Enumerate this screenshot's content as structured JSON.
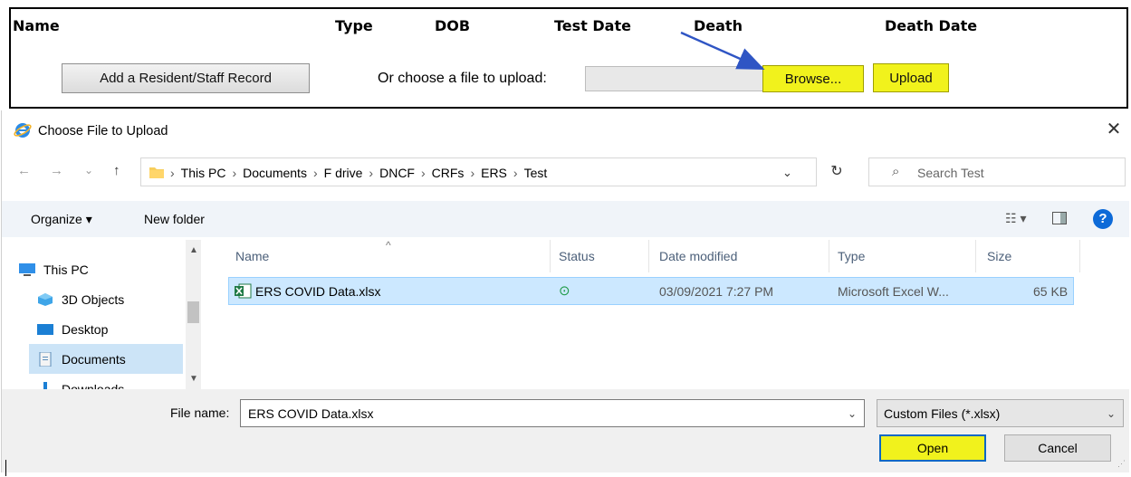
{
  "web_form": {
    "columns": [
      "Name",
      "Type",
      "DOB",
      "Test Date",
      "Death",
      "Death Date"
    ],
    "add_record_label": "Add a Resident/Staff Record",
    "upload_prompt": "Or choose a file to upload:",
    "browse_label": "Browse...",
    "upload_label": "Upload",
    "highlight_color": "#f1f21c",
    "arrow_color": "#2f55c4"
  },
  "dialog": {
    "title": "Choose File to Upload",
    "close_glyph": "✕",
    "nav": {
      "back": "←",
      "forward": "→",
      "recent": "⌄",
      "up": "↑"
    },
    "breadcrumb": [
      "This PC",
      "Documents",
      "F drive",
      "DNCF",
      "CRFs",
      "ERS",
      "Test"
    ],
    "breadcrumb_sep": "›",
    "address_dropdown": "⌄",
    "refresh_glyph": "↻",
    "search_placeholder": "Search Test",
    "search_glyph": "⌕",
    "toolbar": {
      "organize": "Organize ▾",
      "new_folder": "New folder",
      "view_glyph": "☷ ▾",
      "help": "?"
    },
    "tree": [
      {
        "label": "This PC",
        "icon": "pc-icon",
        "selected": false
      },
      {
        "label": "3D Objects",
        "icon": "cube-icon",
        "selected": false
      },
      {
        "label": "Desktop",
        "icon": "desktop-icon",
        "selected": false
      },
      {
        "label": "Documents",
        "icon": "documents-icon",
        "selected": true
      },
      {
        "label": "Downloads",
        "icon": "downloads-icon",
        "selected": false
      }
    ],
    "scroll": {
      "up": "▲",
      "down": "▼"
    },
    "columns": {
      "name": "Name",
      "status": "Status",
      "date_modified": "Date modified",
      "type": "Type",
      "size": "Size",
      "sort_caret": "^"
    },
    "files": [
      {
        "name": "ERS COVID Data.xlsx",
        "status_glyph": "⊙",
        "date_modified": "03/09/2021 7:27 PM",
        "type": "Microsoft Excel W...",
        "size": "65 KB"
      }
    ],
    "file_name_label": "File name:",
    "file_name_value": "ERS COVID Data.xlsx",
    "file_name_dropdown": "⌄",
    "filter_value": "Custom Files (*.xlsx)",
    "filter_dropdown": "⌄",
    "open_label": "Open",
    "cancel_label": "Cancel",
    "grip_glyph": "⋰",
    "selection_color": "#cce8ff",
    "accent_color": "#0a68c4"
  }
}
